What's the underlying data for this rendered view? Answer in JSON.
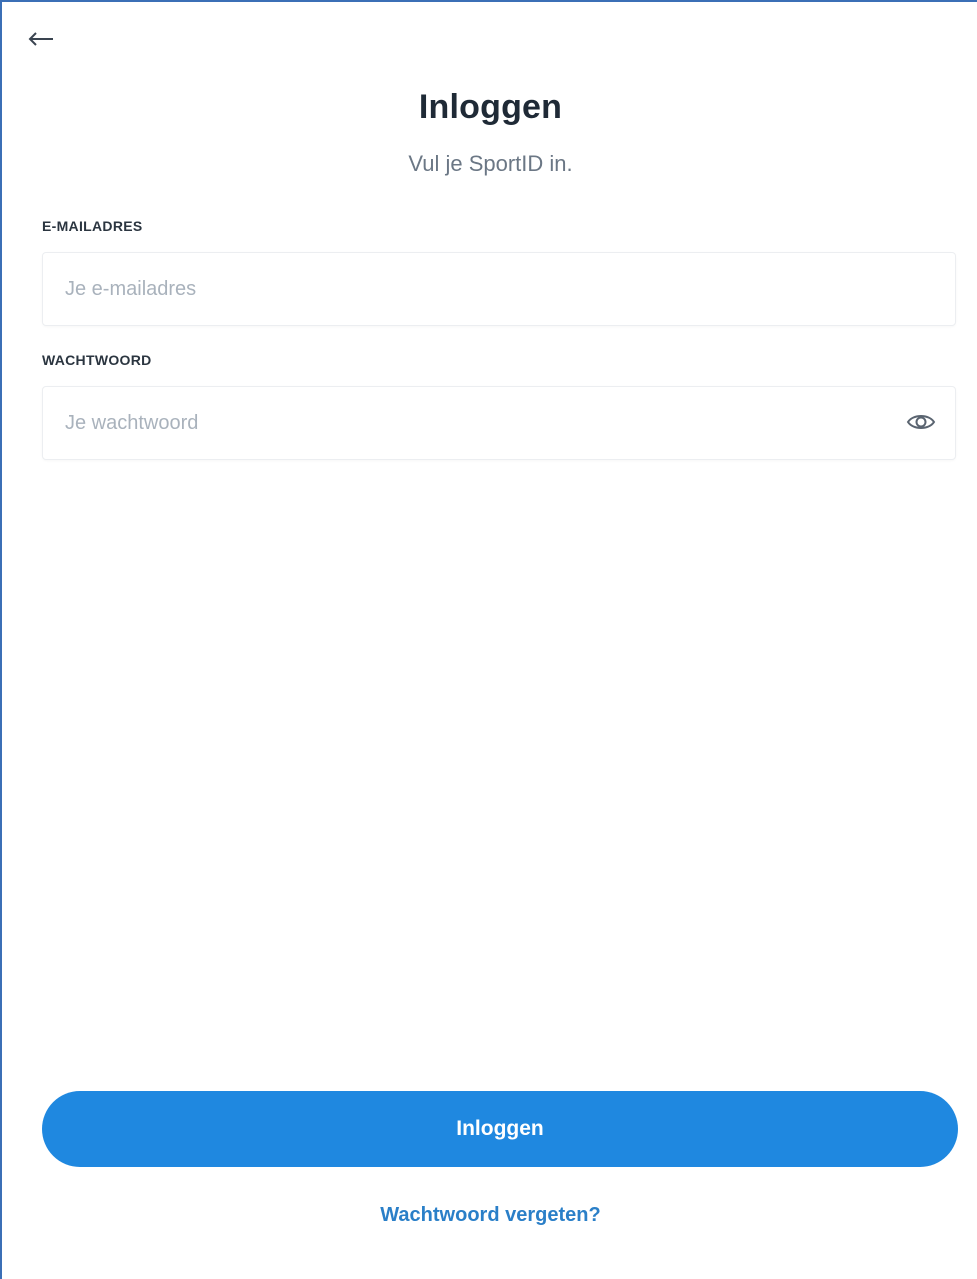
{
  "header": {
    "back_icon": "arrow-left-icon",
    "title": "Inloggen",
    "subtitle": "Vul je SportID in."
  },
  "form": {
    "email": {
      "label": "E-MAILADRES",
      "placeholder": "Je e-mailadres",
      "value": ""
    },
    "password": {
      "label": "WACHTWOORD",
      "placeholder": "Je wachtwoord",
      "value": "",
      "toggle_icon": "eye-icon"
    }
  },
  "actions": {
    "login_label": "Inloggen",
    "forgot_label": "Wachtwoord vergeten?"
  },
  "colors": {
    "primary": "#1f88e0",
    "link": "#2a7fc8",
    "title": "#1f2a36",
    "muted": "#6b7785"
  }
}
